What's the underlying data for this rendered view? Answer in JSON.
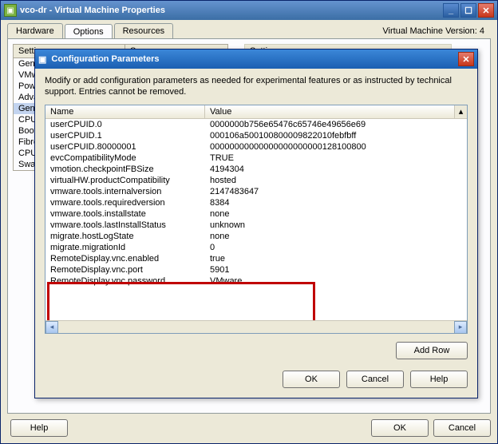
{
  "window": {
    "title": "vco-dr - Virtual Machine Properties",
    "version_label": "Virtual Machine Version: 4"
  },
  "main_tabs": {
    "hardware": "Hardware",
    "options": "Options",
    "resources": "Resources"
  },
  "columns": {
    "settings_header": "Settings",
    "summary_header": "Summary",
    "side_group": "Settings"
  },
  "sidebar_items": [
    "Genera",
    "VMware",
    "Power",
    "Advanc",
    "Gene",
    "CPUI",
    "Boot",
    "Fibre",
    "CPU/",
    "Swap"
  ],
  "dialog": {
    "title": "Configuration Parameters",
    "description": "Modify or add configuration parameters as needed for experimental features or as instructed by technical support. Entries cannot be removed.",
    "col_name": "Name",
    "col_value": "Value",
    "rows": [
      {
        "name": "userCPUID.0",
        "value": "0000000b756e65476c65746e49656e69"
      },
      {
        "name": "userCPUID.1",
        "value": "000106a500100800009822010febfbff"
      },
      {
        "name": "userCPUID.80000001",
        "value": "00000000000000000000000128100800"
      },
      {
        "name": "evcCompatibilityMode",
        "value": "TRUE"
      },
      {
        "name": "vmotion.checkpointFBSize",
        "value": "4194304"
      },
      {
        "name": "virtualHW.productCompatibility",
        "value": "hosted"
      },
      {
        "name": "vmware.tools.internalversion",
        "value": "2147483647"
      },
      {
        "name": "vmware.tools.requiredversion",
        "value": "8384"
      },
      {
        "name": "vmware.tools.installstate",
        "value": "none"
      },
      {
        "name": "vmware.tools.lastInstallStatus",
        "value": "unknown"
      },
      {
        "name": "migrate.hostLogState",
        "value": "none"
      },
      {
        "name": "migrate.migrationId",
        "value": "0"
      },
      {
        "name": "RemoteDisplay.vnc.enabled",
        "value": "true"
      },
      {
        "name": "RemoteDisplay.vnc.port",
        "value": "5901"
      },
      {
        "name": "RemoteDisplay.vnc.password",
        "value": "VMware"
      }
    ],
    "add_row": "Add Row",
    "ok": "OK",
    "cancel": "Cancel",
    "help": "Help"
  },
  "main_buttons": {
    "help": "Help",
    "ok": "OK",
    "cancel": "Cancel"
  }
}
